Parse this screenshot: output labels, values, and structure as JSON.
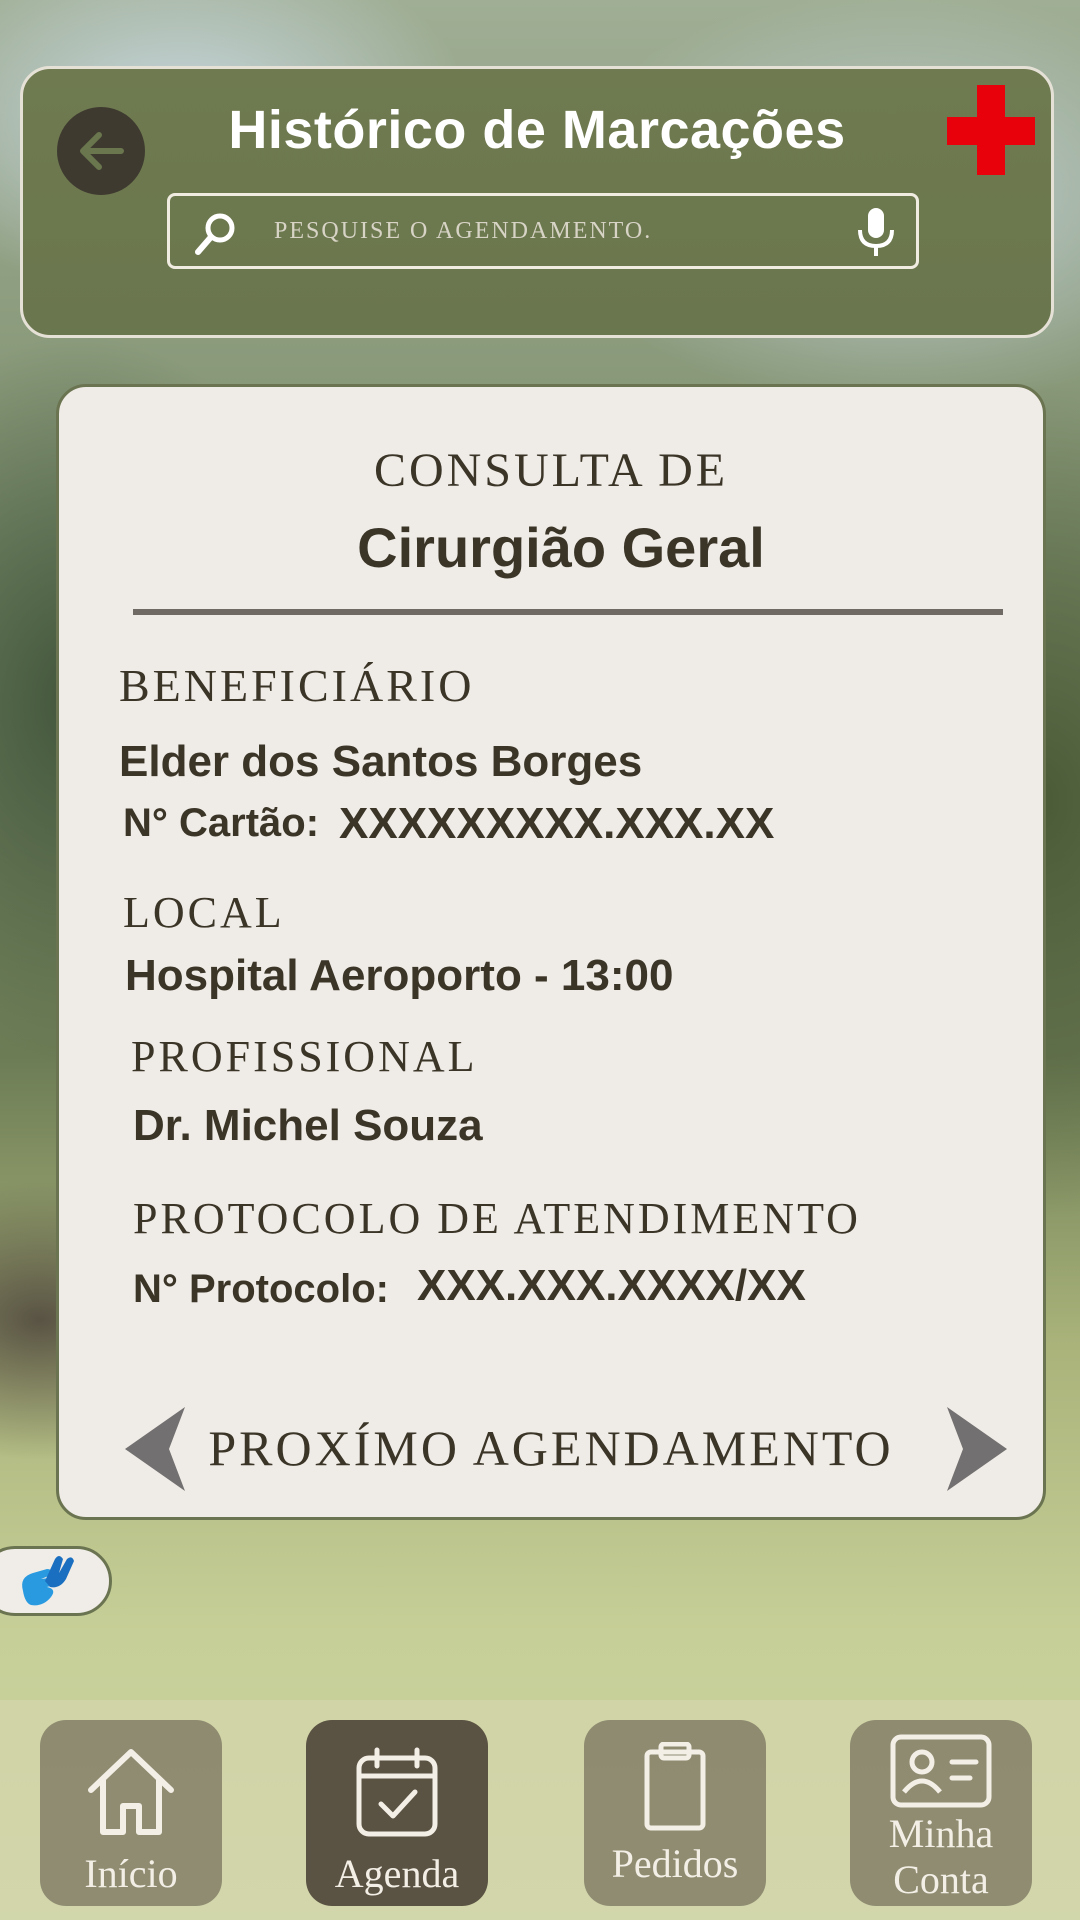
{
  "header": {
    "title": "Histórico de Marcações",
    "search_placeholder": "PESQUISE O AGENDAMENTO."
  },
  "card": {
    "subtitle": "CONSULTA DE",
    "title": "Cirurgião Geral",
    "beneficiary_label": "BENEFICIÁRIO",
    "beneficiary_name": "Elder dos Santos Borges",
    "card_number_label": "N° Cartão:",
    "card_number": "XXXXXXXXX.XXX.XX",
    "location_label": "LOCAL",
    "location": "Hospital Aeroporto - 13:00",
    "professional_label": "PROFISSIONAL",
    "professional": "Dr. Michel Souza",
    "protocol_section_label": "PROTOCOLO DE ATENDIMENTO",
    "protocol_number_label": "N° Protocolo:",
    "protocol_number": "XXX.XXX.XXXX/XX",
    "next_label": "PROXÍMO AGENDAMENTO"
  },
  "nav": {
    "home": "Início",
    "agenda": "Agenda",
    "orders": "Pedidos",
    "account_line1": "Minha",
    "account_line2": "Conta",
    "active": "agenda"
  },
  "colors": {
    "header_bg": "#6a764d",
    "card_bg": "#efebe6",
    "text_dark": "#3b3528",
    "brand_cross": "#e8000b",
    "nav_active": "#5a5242"
  },
  "icons": [
    "back-arrow-icon",
    "red-cross-icon",
    "search-icon",
    "microphone-icon",
    "chevron-left-icon",
    "chevron-right-icon",
    "sign-language-icon",
    "home-icon",
    "calendar-check-icon",
    "clipboard-icon",
    "id-card-icon"
  ]
}
